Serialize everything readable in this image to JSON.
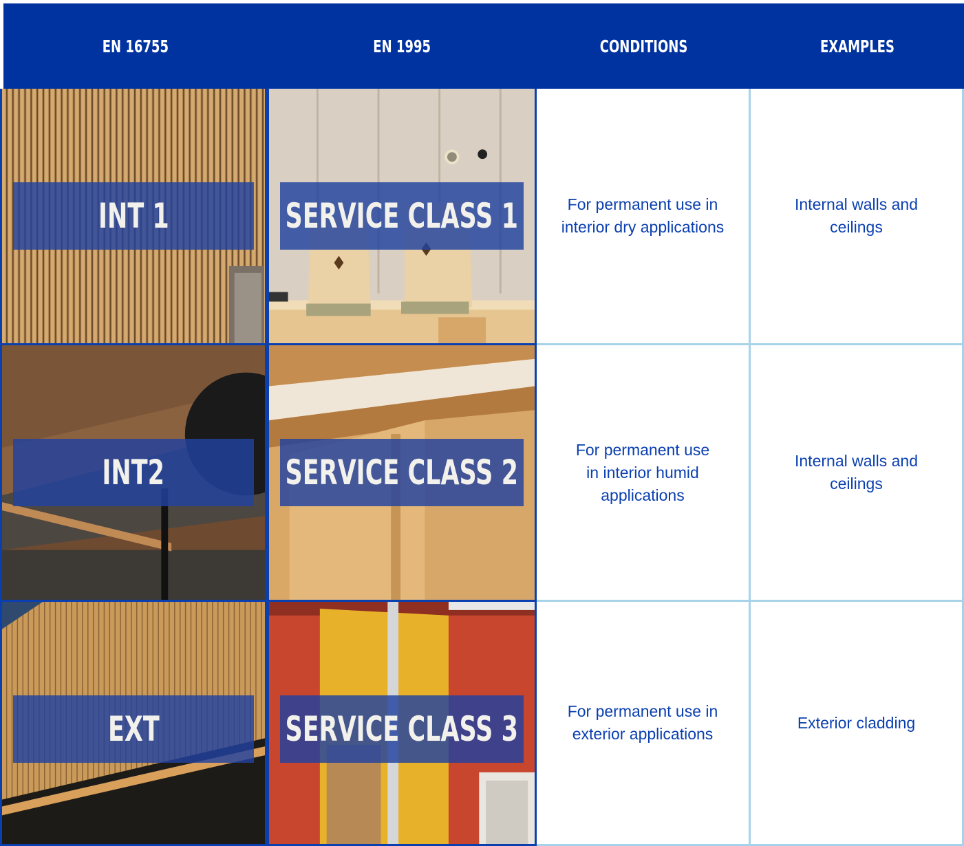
{
  "headers": [
    "EN 16755",
    "EN 1995",
    "CONDITIONS",
    "EXAMPLES"
  ],
  "rows": [
    {
      "en16755": "INT 1",
      "en1995": "SERVICE CLASS 1",
      "conditions": "For permanent use in\ninterior dry applications",
      "examples": "Internal walls and\nceilings"
    },
    {
      "en16755": "INT2",
      "en1995": "SERVICE CLASS 2",
      "conditions": "For permanent use\nin interior humid\napplications",
      "examples": "Internal walls and\nceilings"
    },
    {
      "en16755": "EXT",
      "en1995": "SERVICE CLASS 3",
      "conditions": "For permanent use in\nexterior applications",
      "examples": "Exterior cladding"
    }
  ],
  "colors": {
    "header_bg": "#0033a0",
    "text_blue": "#0a3fb0",
    "grid_light_blue": "#a7d3ea",
    "overlay_blue": "#2142a0"
  }
}
